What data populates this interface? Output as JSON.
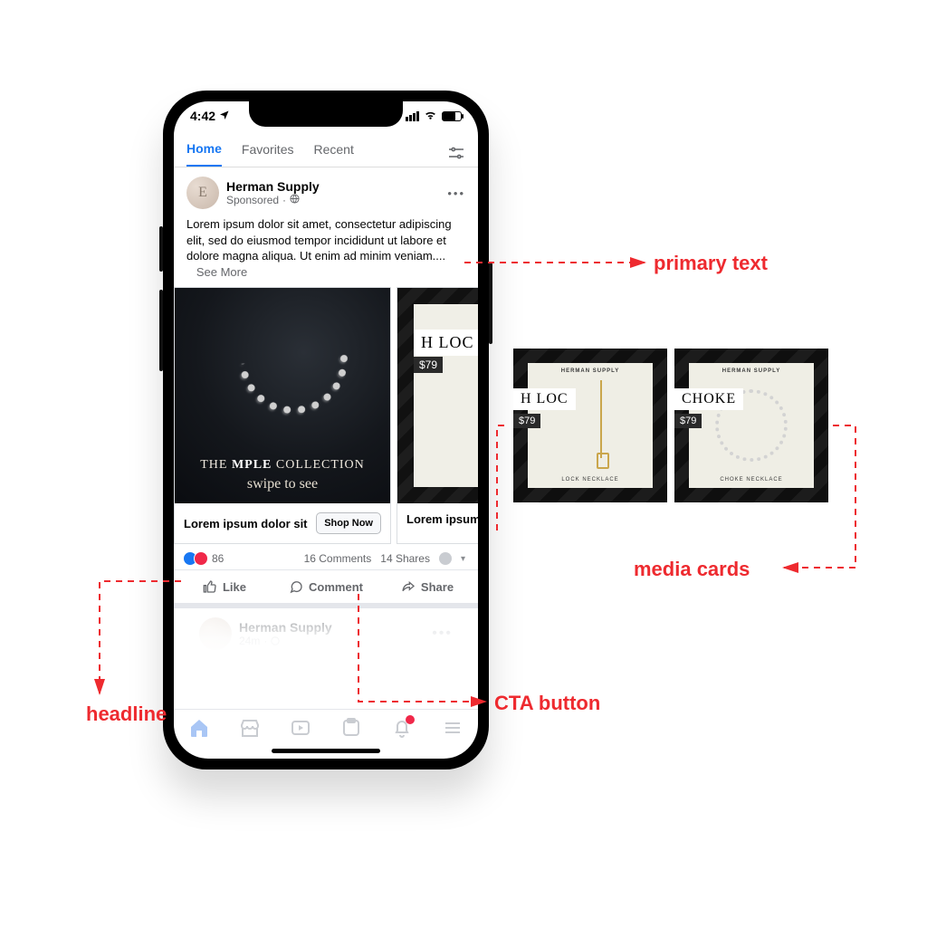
{
  "statusbar": {
    "time": "4:42"
  },
  "tabs": {
    "home": "Home",
    "favorites": "Favorites",
    "recent": "Recent"
  },
  "post": {
    "page_name": "Herman Supply",
    "sponsored": "Sponsored",
    "avatar_initial": "E",
    "body": "Lorem ipsum dolor sit amet, consectetur adipiscing elit, sed do eiusmod tempor incididunt ut labore et dolore magna aliqua. Ut enim ad minim veniam....",
    "see_more": "See More"
  },
  "carousel": {
    "card1": {
      "collection_pre": "THE ",
      "collection_mid": "MPLE",
      "collection_post": " COLLECTION",
      "swipe": "swipe to see",
      "headline": "Lorem ipsum dolor sit",
      "cta": "Shop Now"
    },
    "card2": {
      "tag": "H LOC",
      "price": "$79",
      "headline": "Lorem ipsum"
    }
  },
  "engagement": {
    "count": "86",
    "comments": "16 Comments",
    "shares": "14 Shares"
  },
  "actions": {
    "like": "Like",
    "comment": "Comment",
    "share": "Share"
  },
  "next_post": {
    "name": "Herman Supply",
    "time": "24m"
  },
  "out_cards": {
    "a": {
      "brand": "HERMAN SUPPLY",
      "tag": "H LOC",
      "price": "$79",
      "cap": "LOCK NECKLACE"
    },
    "b": {
      "brand": "HERMAN SUPPLY",
      "tag": "CHOKE",
      "price": "$79",
      "cap": "CHOKE NECKLACE"
    }
  },
  "labels": {
    "primary": "primary text",
    "media": "media cards",
    "cta": "CTA button",
    "headline": "headline"
  }
}
